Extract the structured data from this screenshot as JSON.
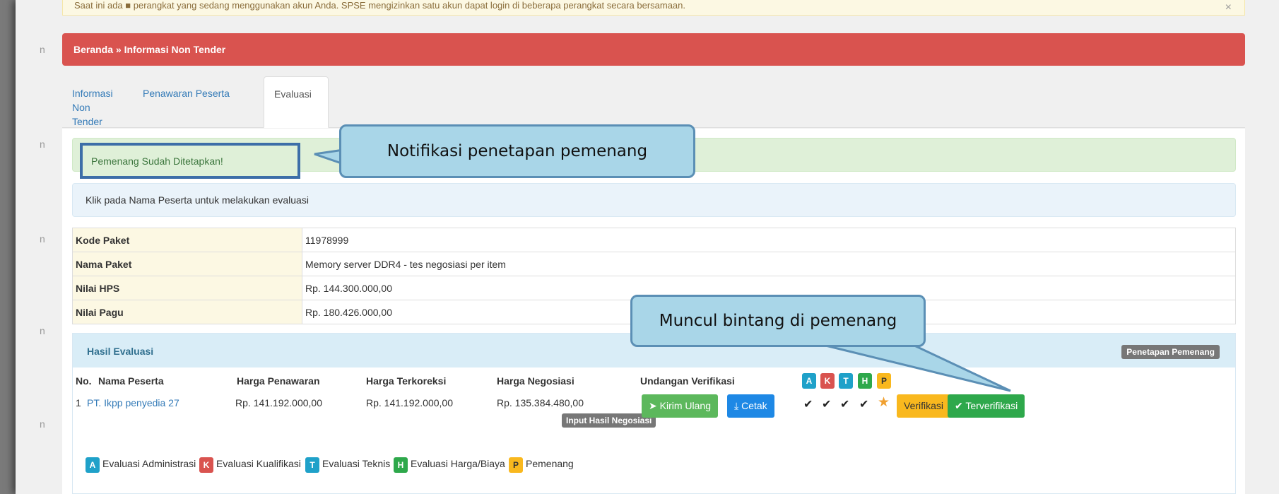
{
  "alert_top": {
    "text": "Saat ini ada ■ perangkat yang sedang menggunakan akun Anda. SPSE mengizinkan satu akun dapat login di beberapa perangkat secara bersamaan.",
    "close": "×"
  },
  "breadcrumb": "Beranda » Informasi Non Tender",
  "tabs": [
    {
      "label": "Informasi Non Tender"
    },
    {
      "label": "Penawaran Peserta"
    },
    {
      "label": "Evaluasi"
    }
  ],
  "notif_success": "Pemenang Sudah Ditetapkan!",
  "info_text": "Klik pada Nama Peserta untuk melakukan evaluasi",
  "detail": [
    {
      "key": "Kode Paket",
      "value": "11978999"
    },
    {
      "key": "Nama Paket",
      "value": "Memory server DDR4 - tes negosiasi per item"
    },
    {
      "key": "Nilai HPS",
      "value": "Rp. 144.300.000,00"
    },
    {
      "key": "Nilai Pagu",
      "value": "Rp. 180.426.000,00"
    }
  ],
  "hasil": {
    "title": "Hasil Evaluasi",
    "penetapan_button": "Penetapan Pemenang",
    "columns": {
      "no": "No.",
      "nama": "Nama Peserta",
      "harga_penawaran": "Harga Penawaran",
      "harga_terkoreksi": "Harga Terkoreksi",
      "harga_negosiasi": "Harga Negosiasi",
      "undangan": "Undangan Verifikasi"
    },
    "badges": [
      "A",
      "K",
      "T",
      "H",
      "P"
    ],
    "row": {
      "no": "1",
      "nama": "PT. Ikpp penyedia 27",
      "harga_penawaran": "Rp. 141.192.000,00",
      "harga_terkoreksi": "Rp. 141.192.000,00",
      "harga_negosiasi": "Rp. 135.384.480,00",
      "input_negosiasi": "Input Hasil Negosiasi",
      "kirim_ulang": "Kirim Ulang",
      "cetak": "Cetak",
      "verifikasi": "Verifikasi",
      "terverifikasi": "Terverifikasi"
    },
    "legend": [
      {
        "badge": "A",
        "label": "Evaluasi Administrasi"
      },
      {
        "badge": "K",
        "label": "Evaluasi Kualifikasi"
      },
      {
        "badge": "T",
        "label": "Evaluasi Teknis"
      },
      {
        "badge": "H",
        "label": "Evaluasi Harga/Biaya"
      },
      {
        "badge": "P",
        "label": "Pemenang"
      }
    ]
  },
  "callouts": {
    "notifikasi": "Notifikasi penetapan pemenang",
    "bintang": "Muncul bintang di pemenang"
  },
  "colors": {
    "breadcrumb_bg": "#d9534f",
    "success_bg": "#dff0d8",
    "info_bg": "#d9edf7",
    "callout_bg": "#a9d6e8",
    "callout_border": "#5b8fb5"
  },
  "icons": [
    "close-icon",
    "paper-plane-icon",
    "download-icon",
    "check-icon",
    "star-icon"
  ]
}
